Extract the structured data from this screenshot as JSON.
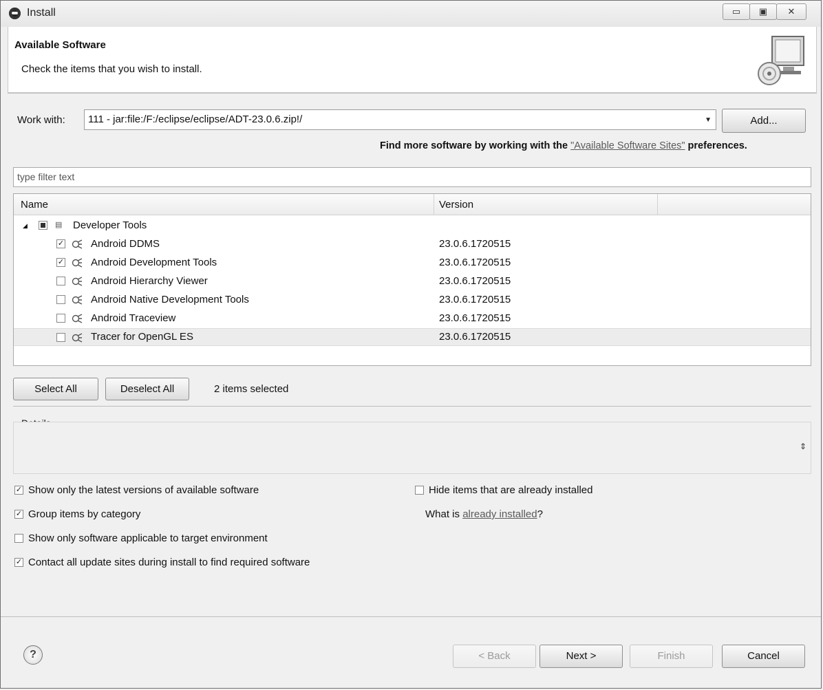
{
  "window": {
    "title": "Install",
    "controls": {
      "minimize": "▭",
      "maximize": "▣",
      "close": "✕"
    }
  },
  "header": {
    "title": "Available Software",
    "subtitle": "Check the items that you wish to install."
  },
  "work_with": {
    "label": "Work with:",
    "value": "111 - jar:file:/F:/eclipse/eclipse/ADT-23.0.6.zip!/",
    "add_button": "Add...",
    "find_more_prefix": "Find more software by working with the ",
    "find_more_link": "\"Available Software Sites\"",
    "find_more_suffix": " preferences."
  },
  "filter": {
    "placeholder": "type filter text"
  },
  "tree": {
    "columns": {
      "name": "Name",
      "version": "Version"
    },
    "category": {
      "label": "Developer Tools",
      "state": "partial"
    },
    "items": [
      {
        "label": "Android DDMS",
        "version": "23.0.6.1720515",
        "checked": true
      },
      {
        "label": "Android Development Tools",
        "version": "23.0.6.1720515",
        "checked": true
      },
      {
        "label": "Android Hierarchy Viewer",
        "version": "23.0.6.1720515",
        "checked": false
      },
      {
        "label": "Android Native Development Tools",
        "version": "23.0.6.1720515",
        "checked": false
      },
      {
        "label": "Android Traceview",
        "version": "23.0.6.1720515",
        "checked": false
      },
      {
        "label": "Tracer for OpenGL ES",
        "version": "23.0.6.1720515",
        "checked": false,
        "selected": true
      }
    ]
  },
  "selection": {
    "select_all": "Select All",
    "deselect_all": "Deselect All",
    "status": "2 items selected"
  },
  "details": {
    "label": "Details"
  },
  "options": {
    "show_latest": {
      "label": "Show only the latest versions of available software",
      "checked": true
    },
    "group_by_category": {
      "label": "Group items by category",
      "checked": true
    },
    "target_env": {
      "label": "Show only software applicable to target environment",
      "checked": false
    },
    "contact_sites": {
      "label": "Contact all update sites during install to find required software",
      "checked": true
    },
    "hide_installed": {
      "label": "Hide items that are already installed",
      "checked": false
    },
    "what_is_prefix": "What is ",
    "what_is_link": "already installed",
    "what_is_suffix": "?"
  },
  "footer": {
    "help": "?",
    "back": "< Back",
    "next": "Next >",
    "finish": "Finish",
    "cancel": "Cancel"
  }
}
